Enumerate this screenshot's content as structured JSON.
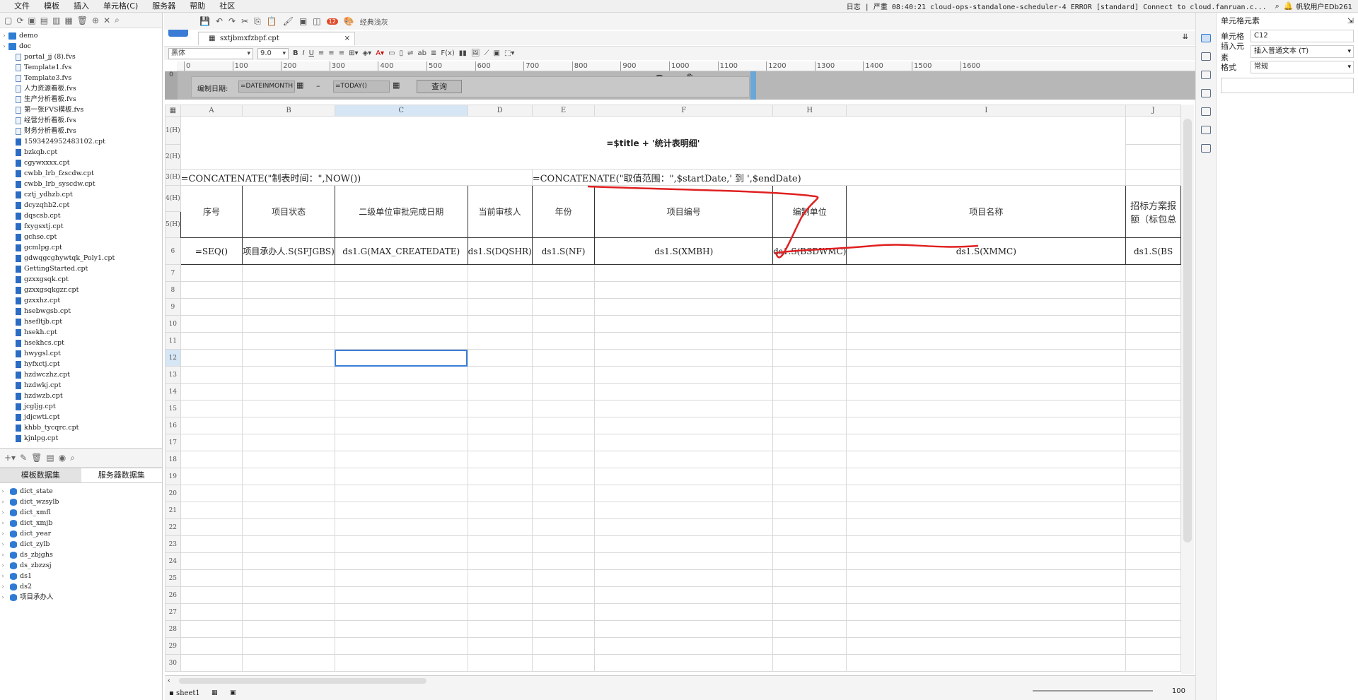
{
  "menu": [
    "文件",
    "模板",
    "插入",
    "单元格(C)",
    "服务器",
    "帮助",
    "社区"
  ],
  "status_line": "日志 | 严重 08:40:21 cloud-ops-standalone-scheduler-4 ERROR [standard] Connect to cloud.fanruan.c...",
  "user": "帆软用户EDb261",
  "files": [
    {
      "name": "demo",
      "type": "folder"
    },
    {
      "name": "doc",
      "type": "folder"
    },
    {
      "name": "portal_jj (8).fvs",
      "type": "fvs"
    },
    {
      "name": "Template1.fvs",
      "type": "fvs"
    },
    {
      "name": "Template3.fvs",
      "type": "fvs"
    },
    {
      "name": "人力资源看板.fvs",
      "type": "fvs"
    },
    {
      "name": "生产分析看板.fvs",
      "type": "fvs"
    },
    {
      "name": "第一张FVS模板.fvs",
      "type": "fvs"
    },
    {
      "name": "经营分析看板.fvs",
      "type": "fvs"
    },
    {
      "name": "财务分析看板.fvs",
      "type": "fvs"
    },
    {
      "name": "1593424952483102.cpt",
      "type": "cpt"
    },
    {
      "name": "bzkqb.cpt",
      "type": "cpt"
    },
    {
      "name": "cgywxxxx.cpt",
      "type": "cpt"
    },
    {
      "name": "cwbb_lrb_fzscdw.cpt",
      "type": "cpt"
    },
    {
      "name": "cwbb_lrb_syscdw.cpt",
      "type": "cpt"
    },
    {
      "name": "cztj_ydhzb.cpt",
      "type": "cpt"
    },
    {
      "name": "dcyzqhb2.cpt",
      "type": "cpt"
    },
    {
      "name": "dqscsb.cpt",
      "type": "cpt"
    },
    {
      "name": "fxygsxtj.cpt",
      "type": "cpt"
    },
    {
      "name": "gchse.cpt",
      "type": "cpt"
    },
    {
      "name": "gcmlpg.cpt",
      "type": "cpt"
    },
    {
      "name": "gdwqgcghywtqk_Poly1.cpt",
      "type": "cpt"
    },
    {
      "name": "GettingStarted.cpt",
      "type": "cpt"
    },
    {
      "name": "gzxxgsqk.cpt",
      "type": "cpt"
    },
    {
      "name": "gzxxgsqkgzr.cpt",
      "type": "cpt"
    },
    {
      "name": "gzxxhz.cpt",
      "type": "cpt"
    },
    {
      "name": "hsebwgsb.cpt",
      "type": "cpt"
    },
    {
      "name": "hsefltjb.cpt",
      "type": "cpt"
    },
    {
      "name": "hsekh.cpt",
      "type": "cpt"
    },
    {
      "name": "hsekhcs.cpt",
      "type": "cpt"
    },
    {
      "name": "hwygsl.cpt",
      "type": "cpt"
    },
    {
      "name": "hyfxctj.cpt",
      "type": "cpt"
    },
    {
      "name": "hzdwczhz.cpt",
      "type": "cpt"
    },
    {
      "name": "hzdwkj.cpt",
      "type": "cpt"
    },
    {
      "name": "hzdwzb.cpt",
      "type": "cpt"
    },
    {
      "name": "jcgljg.cpt",
      "type": "cpt"
    },
    {
      "name": "jdjcwti.cpt",
      "type": "cpt"
    },
    {
      "name": "khbb_tycqrc.cpt",
      "type": "cpt"
    },
    {
      "name": "kjnlpg.cpt",
      "type": "cpt"
    }
  ],
  "ds_tabs": [
    "模板数据集",
    "服务器数据集"
  ],
  "datasets": [
    "dict_state",
    "dict_wzsylb",
    "dict_xmfl",
    "dict_xmjb",
    "dict_year",
    "dict_zylb",
    "ds_zbjghs",
    "ds_zbzzsj",
    "ds1",
    "ds2",
    "项目承办人"
  ],
  "file_tab": "sxtjbmxfzbpf.cpt",
  "classic_btn": "经典浅灰",
  "badge_count": "12",
  "font_name": "黑体",
  "font_size": "9.0",
  "ruler_ticks": [
    "0",
    "100",
    "200",
    "300",
    "400",
    "500",
    "600",
    "700",
    "800",
    "900",
    "1000",
    "1100",
    "1200",
    "1300",
    "1400",
    "1500",
    "1600"
  ],
  "params": {
    "label": "编制日期:",
    "start": "=DATEINMONTH",
    "dash": "–",
    "end": "=TODAY()",
    "query": "查询"
  },
  "columns": [
    "A",
    "B",
    "C",
    "D",
    "E",
    "F",
    "H",
    "I",
    "J"
  ],
  "rows": {
    "r1": "1(H)",
    "r2": "2(H)",
    "r3": "3(H)",
    "r4": "4(H)",
    "r5": "5(H)",
    "r6": "6",
    "title_formula": "=$title + '统计表明细'",
    "row3_left": "=CONCATENATE(\"制表时间：\",NOW())",
    "row3_right": "=CONCATENATE(\"取值范围：\",$startDate,' 到 ',$endDate)",
    "headers": [
      "序号",
      "项目状态",
      "二级单位审批完成日期",
      "当前审核人",
      "年份",
      "项目编号",
      "编制单位",
      "项目名称",
      "招标方案报额（标包总"
    ],
    "formulas": [
      "=SEQ()",
      "项目承办人.S(SFJGBS)",
      "ds1.G(MAX_CREATEDATE)",
      "ds1.S(DQSHR)",
      "ds1.S(NF)",
      "ds1.S(XMBH)",
      "ds1.S(BSDWMC)",
      "ds1.S(XMMC)",
      "ds1.S(BS"
    ]
  },
  "empty_rows": [
    "7",
    "8",
    "9",
    "10",
    "11",
    "12",
    "13",
    "14",
    "15",
    "16",
    "17",
    "18",
    "19",
    "20",
    "21",
    "22",
    "23",
    "24",
    "25",
    "26",
    "27",
    "28",
    "29",
    "30"
  ],
  "selected_cell_row": "12",
  "sheet_tab": "sheet1",
  "zoom": "100",
  "props": {
    "title": "单元格元素",
    "cell_label": "单元格",
    "cell_value": "C12",
    "insert_label": "插入元素",
    "insert_value": "插入普通文本 (T)",
    "format_label": "格式",
    "format_value": "常规"
  }
}
